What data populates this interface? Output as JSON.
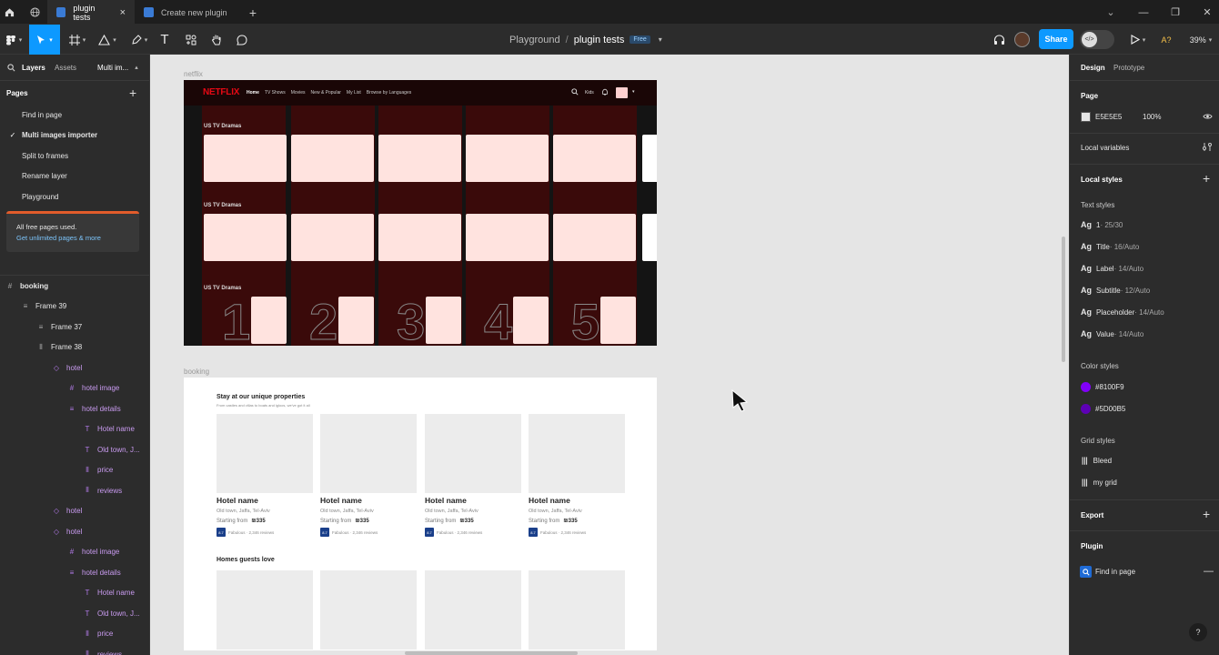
{
  "tabs": [
    {
      "label": "plugin tests",
      "close": "×"
    },
    {
      "label": "Create new plugin"
    }
  ],
  "window_controls": {
    "expand": "⌄",
    "minimize": "—",
    "restore": "❐",
    "close": "✕"
  },
  "toolbar": {
    "breadcrumb_project": "Playground",
    "breadcrumb_sep": "/",
    "file_name": "plugin tests",
    "plan_badge": "Free",
    "share_label": "Share",
    "a_label": "A?",
    "zoom": "39%"
  },
  "left_panel": {
    "tab_layers": "Layers",
    "tab_assets": "Assets",
    "page_dropdown": "Multi im...",
    "pages_title": "Pages",
    "pages": [
      {
        "label": "Find in page",
        "active": false
      },
      {
        "label": "Multi images importer",
        "active": true
      },
      {
        "label": "Split to frames",
        "active": false
      },
      {
        "label": "Rename layer",
        "active": false
      },
      {
        "label": "Playground",
        "active": false
      }
    ],
    "notice_text": "All free pages used.",
    "notice_link": "Get unlimited pages & more",
    "layers": [
      {
        "label": "booking",
        "icon": "#",
        "indent": 0,
        "purple": false,
        "bold": true
      },
      {
        "label": "Frame 39",
        "icon": "≡",
        "indent": 1,
        "purple": false
      },
      {
        "label": "Frame 37",
        "icon": "≡",
        "indent": 2,
        "purple": false
      },
      {
        "label": "Frame 38",
        "icon": "⦀",
        "indent": 2,
        "purple": false
      },
      {
        "label": "hotel",
        "icon": "◇",
        "indent": 3,
        "purple": true
      },
      {
        "label": "hotel image",
        "icon": "#",
        "indent": 4,
        "purple": true
      },
      {
        "label": "hotel details",
        "icon": "≡",
        "indent": 4,
        "purple": true
      },
      {
        "label": "Hotel name",
        "icon": "T",
        "indent": 5,
        "purple": true
      },
      {
        "label": "Old town, J...",
        "icon": "T",
        "indent": 5,
        "purple": true
      },
      {
        "label": "price",
        "icon": "⦀",
        "indent": 5,
        "purple": true
      },
      {
        "label": "reviews",
        "icon": "⦀",
        "indent": 5,
        "purple": true
      },
      {
        "label": "hotel",
        "icon": "◇",
        "indent": 3,
        "purple": true
      },
      {
        "label": "hotel",
        "icon": "◇",
        "indent": 3,
        "purple": true
      },
      {
        "label": "hotel image",
        "icon": "#",
        "indent": 4,
        "purple": true
      },
      {
        "label": "hotel details",
        "icon": "≡",
        "indent": 4,
        "purple": true
      },
      {
        "label": "Hotel name",
        "icon": "T",
        "indent": 5,
        "purple": true
      },
      {
        "label": "Old town, J...",
        "icon": "T",
        "indent": 5,
        "purple": true
      },
      {
        "label": "price",
        "icon": "⦀",
        "indent": 5,
        "purple": true
      },
      {
        "label": "reviews",
        "icon": "⦀",
        "indent": 5,
        "purple": true
      }
    ]
  },
  "right_panel": {
    "tab_design": "Design",
    "tab_prototype": "Prototype",
    "page_title": "Page",
    "page_color": "E5E5E5",
    "page_opacity": "100%",
    "local_variables": "Local variables",
    "local_styles": "Local styles",
    "text_styles_title": "Text styles",
    "text_styles": [
      {
        "name": "1",
        "spec": " · 25/30"
      },
      {
        "name": "Title",
        "spec": " · 16/Auto"
      },
      {
        "name": "Label",
        "spec": " · 14/Auto"
      },
      {
        "name": "Subtitle",
        "spec": " · 12/Auto"
      },
      {
        "name": "Placeholder",
        "spec": " · 14/Auto"
      },
      {
        "name": "Value",
        "spec": " · 14/Auto"
      }
    ],
    "color_styles_title": "Color styles",
    "color_styles": [
      {
        "name": "#8100F9",
        "color": "#8100f9"
      },
      {
        "name": "#5D00B5",
        "color": "#5d00b5"
      }
    ],
    "grid_styles_title": "Grid styles",
    "grid_styles": [
      "Bleed",
      "my grid"
    ],
    "export_title": "Export",
    "plugin_title": "Plugin",
    "plugin_item": "Find in page",
    "help": "?"
  },
  "canvas": {
    "netflix_label": "netflix",
    "booking_label": "booking",
    "netflix": {
      "logo": "NETFLIX",
      "nav": [
        "Home",
        "TV Shows",
        "Movies",
        "New & Popular",
        "My List",
        "Browse by Languages"
      ],
      "kids": "Kids",
      "row_titles": [
        "US TV Dramas",
        "US TV Dramas",
        "US TV Dramas"
      ],
      "numbers": [
        "1",
        "2",
        "3",
        "4",
        "5"
      ]
    },
    "booking": {
      "section1_title": "Stay at our unique properties",
      "section1_subtitle": "From castles and villas to boats and igloos, we've got it all",
      "hotels": [
        {
          "name": "Hotel name",
          "location": "Old town, Jaffa, Tel-Aviv",
          "price_prefix": "Starting from",
          "price": "₪335",
          "score": "8.7",
          "reviews": "Fabulous · 2,346 reviews"
        },
        {
          "name": "Hotel name",
          "location": "Old town, Jaffa, Tel-Aviv",
          "price_prefix": "Starting from",
          "price": "₪335",
          "score": "8.7",
          "reviews": "Fabulous · 2,346 reviews"
        },
        {
          "name": "Hotel name",
          "location": "Old town, Jaffa, Tel-Aviv",
          "price_prefix": "Starting from",
          "price": "₪335",
          "score": "8.7",
          "reviews": "Fabulous · 2,346 reviews"
        },
        {
          "name": "Hotel name",
          "location": "Old town, Jaffa, Tel-Aviv",
          "price_prefix": "Starting from",
          "price": "₪335",
          "score": "8.7",
          "reviews": "Fabulous · 2,346 reviews"
        }
      ],
      "section2_title": "Homes guests love"
    }
  }
}
